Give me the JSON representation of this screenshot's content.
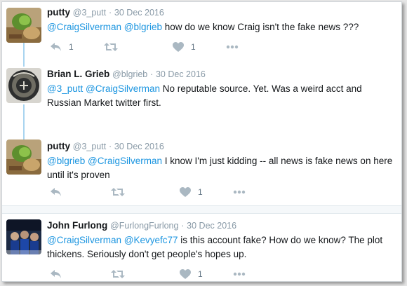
{
  "tweets": [
    {
      "name": "putty",
      "handle": "@3_putt",
      "sep": "·",
      "date": "30 Dec 2016",
      "mentions": [
        "@CraigSilverman",
        "@blgrieb"
      ],
      "text": "how do we know Craig isn't the fake news ???",
      "reply_count": "1",
      "retweet_count": "",
      "like_count": "1"
    },
    {
      "name": "Brian L. Grieb",
      "handle": "@blgrieb",
      "sep": "·",
      "date": "30 Dec 2016",
      "mentions": [
        "@3_putt",
        "@CraigSilverman"
      ],
      "text": "No reputable source. Yet. Was a weird acct and Russian Market twitter first.",
      "reply_count": "",
      "retweet_count": "",
      "like_count": ""
    },
    {
      "name": "putty",
      "handle": "@3_putt",
      "sep": "·",
      "date": "30 Dec 2016",
      "mentions": [
        "@blgrieb",
        "@CraigSilverman"
      ],
      "text": "I know I'm just kidding -- all news is fake news on here until it's proven",
      "reply_count": "",
      "retweet_count": "",
      "like_count": "1"
    },
    {
      "name": "John Furlong",
      "handle": "@FurlongFurlong",
      "sep": "·",
      "date": "30 Dec 2016",
      "mentions": [
        "@CraigSilverman",
        "@Kevyefc77"
      ],
      "text": "is this account fake? How do we know? The plot thickens. Seriously don't get people's hopes up.",
      "reply_count": "",
      "retweet_count": "",
      "like_count": "1"
    }
  ],
  "icons": {
    "reply": "reply-icon",
    "retweet": "retweet-icon",
    "like": "heart-icon",
    "more": "more-icon"
  },
  "colors": {
    "mention": "#1b95e0",
    "icon": "#aab8c2",
    "connector": "#a9d5f0"
  }
}
